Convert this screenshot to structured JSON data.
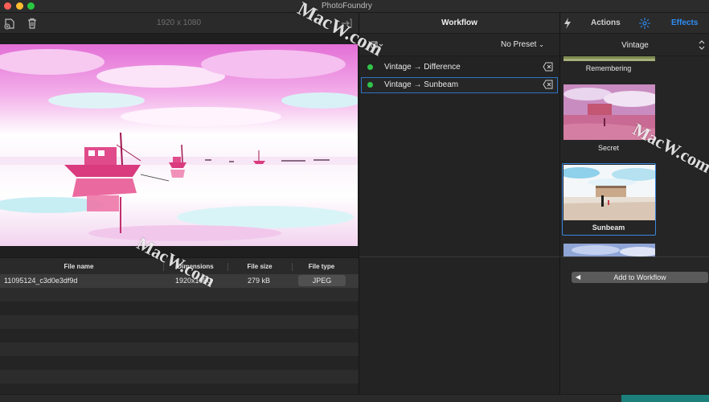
{
  "window": {
    "title": "PhotoFoundry"
  },
  "left_toolbar": {
    "dimensions": "1920 x 1080",
    "icons": [
      "add-photo-icon",
      "trash-icon",
      "export-icon"
    ]
  },
  "file_table": {
    "columns": [
      "File name",
      "Dimensions",
      "File size",
      "File type"
    ],
    "rows": [
      {
        "name": "11095124_c3d0e3df9d",
        "dimensions": "1920x1080",
        "size": "279 kB",
        "type": "JPEG"
      }
    ]
  },
  "workflow": {
    "header": "Workflow",
    "preset": "No Preset",
    "items": [
      {
        "label": "Vintage → Difference",
        "status_color": "#31c44a"
      },
      {
        "label": "Vintage → Sunbeam",
        "status_color": "#31c44a"
      }
    ]
  },
  "effects_panel": {
    "tabs": {
      "actions": "Actions",
      "effects": "Effects"
    },
    "category": "Vintage",
    "effects": [
      {
        "name": "Remembering"
      },
      {
        "name": "Secret"
      },
      {
        "name": "Sunbeam",
        "selected": true
      }
    ],
    "add_button": "Add to Workflow"
  },
  "watermark": [
    "MacW.com",
    "MacW.com",
    "MacW.com"
  ],
  "colors": {
    "accent": "#2f8ef5",
    "selection_border": "#3a87e0",
    "status_green": "#31c44a",
    "teal": "#1c7f7c"
  }
}
